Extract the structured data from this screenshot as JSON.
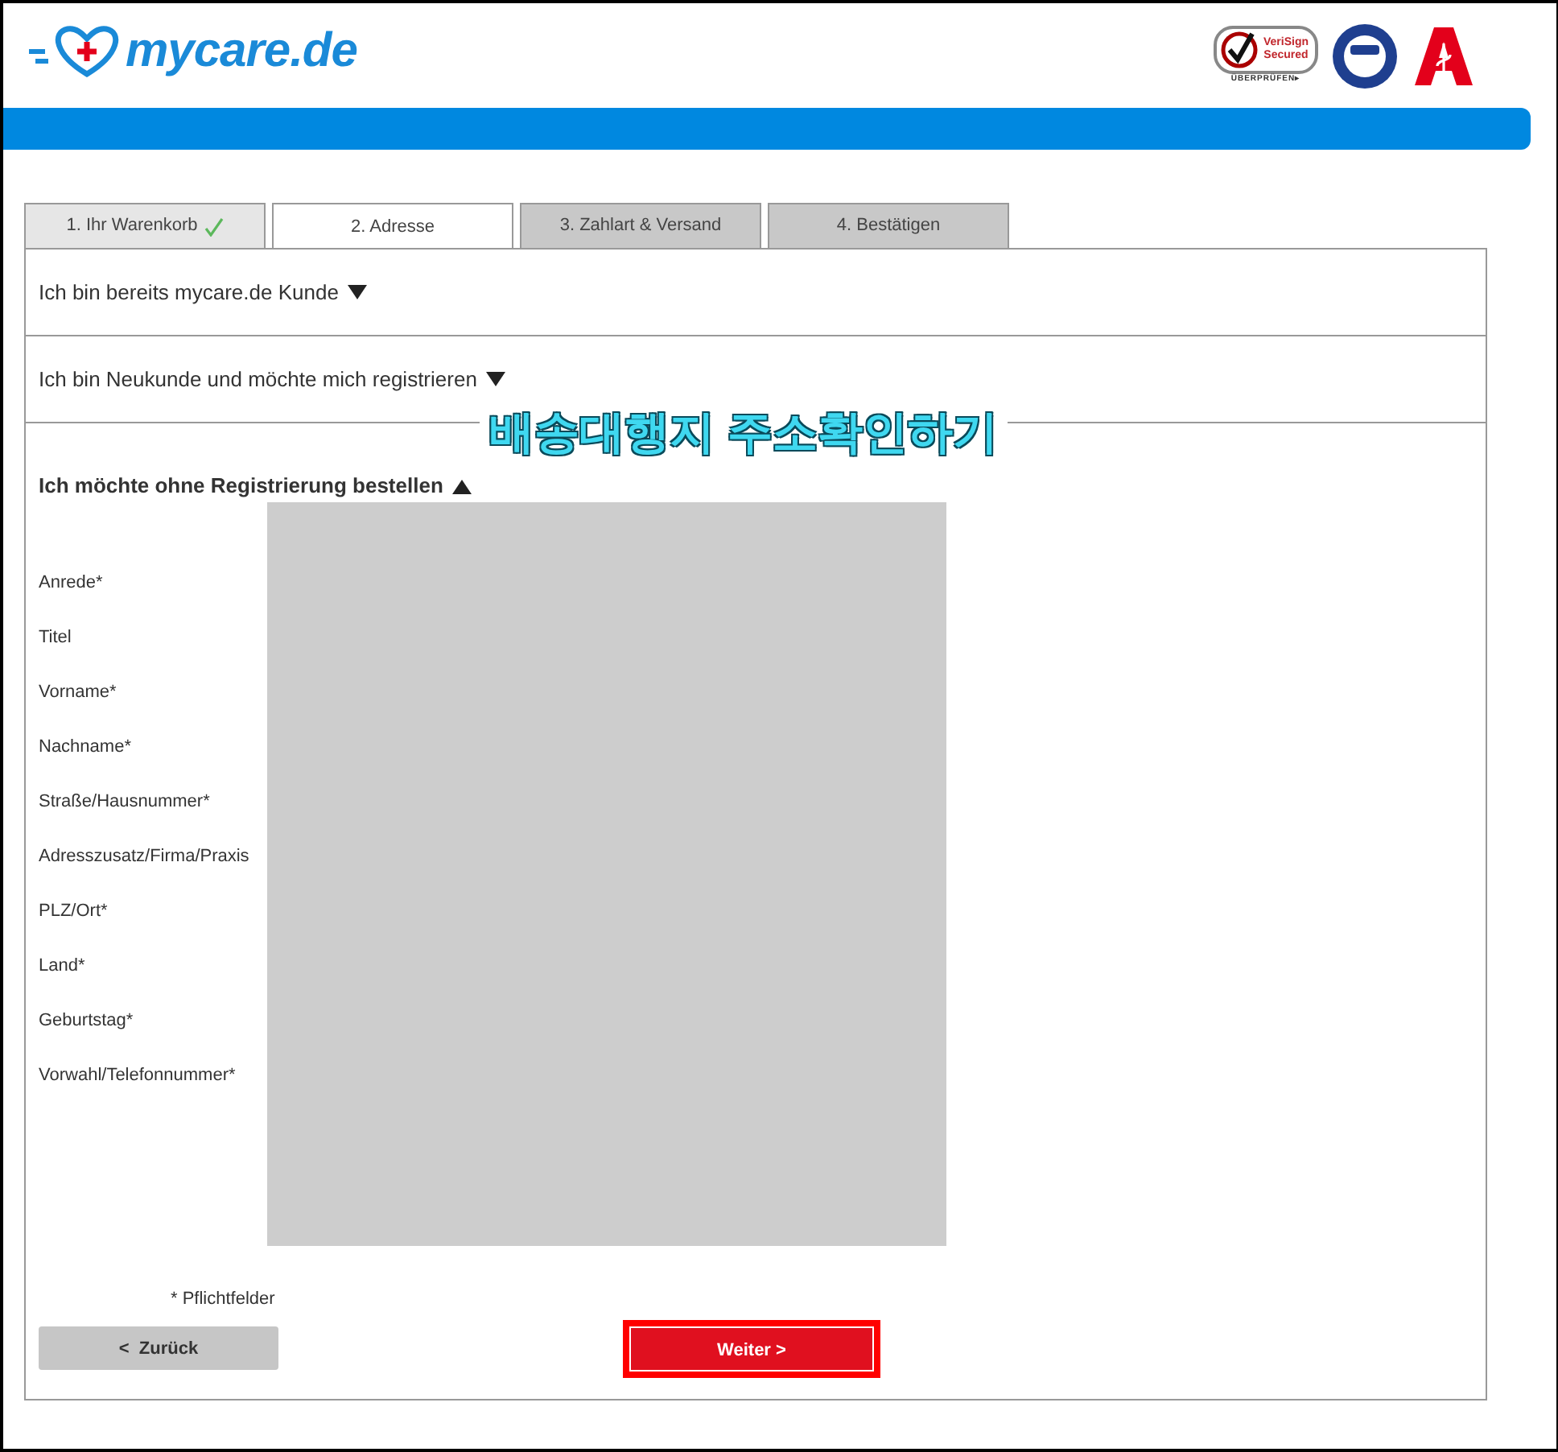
{
  "header": {
    "logo": "mycare.de",
    "badges": [
      {
        "kind": "verisign",
        "line1": "VeriSign",
        "line2": "Secured",
        "footer": "ÜBERPRÜFEN▸"
      },
      {
        "kind": "tuv"
      },
      {
        "kind": "apotheke"
      }
    ]
  },
  "tabs": [
    {
      "label": "1. Ihr Warenkorb",
      "done": true,
      "selected": false
    },
    {
      "label": "2. Adresse",
      "done": false,
      "selected": true
    },
    {
      "label": "3. Zahlart & Versand",
      "done": false,
      "selected": false
    },
    {
      "label": "4. Bestätigen",
      "done": false,
      "selected": false
    }
  ],
  "sections": [
    {
      "title": "Ich bin bereits mycare.de Kunde",
      "expanded": false
    },
    {
      "title": "Ich bin Neukunde und möchte mich registrieren",
      "expanded": false
    },
    {
      "title": "Ich möchte ohne Registrierung bestellen",
      "expanded": true
    }
  ],
  "caption": "배송대행지 주소확인하기",
  "form_labels": [
    "Anrede*",
    "Titel",
    "Vorname*",
    "Nachname*",
    "Straße/Hausnummer*",
    "Adresszusatz/Firma/Praxis",
    "PLZ/Ort*",
    "Land*",
    "Geburtstag*",
    "Vorwahl/Telefonnummer*"
  ],
  "required_note": "* Pflichtfelder",
  "buttons": [
    {
      "kind": "back",
      "label": "<  Zurück",
      "highlighted": false
    },
    {
      "kind": "next",
      "label": "Weiter >",
      "highlighted": true
    }
  ]
}
